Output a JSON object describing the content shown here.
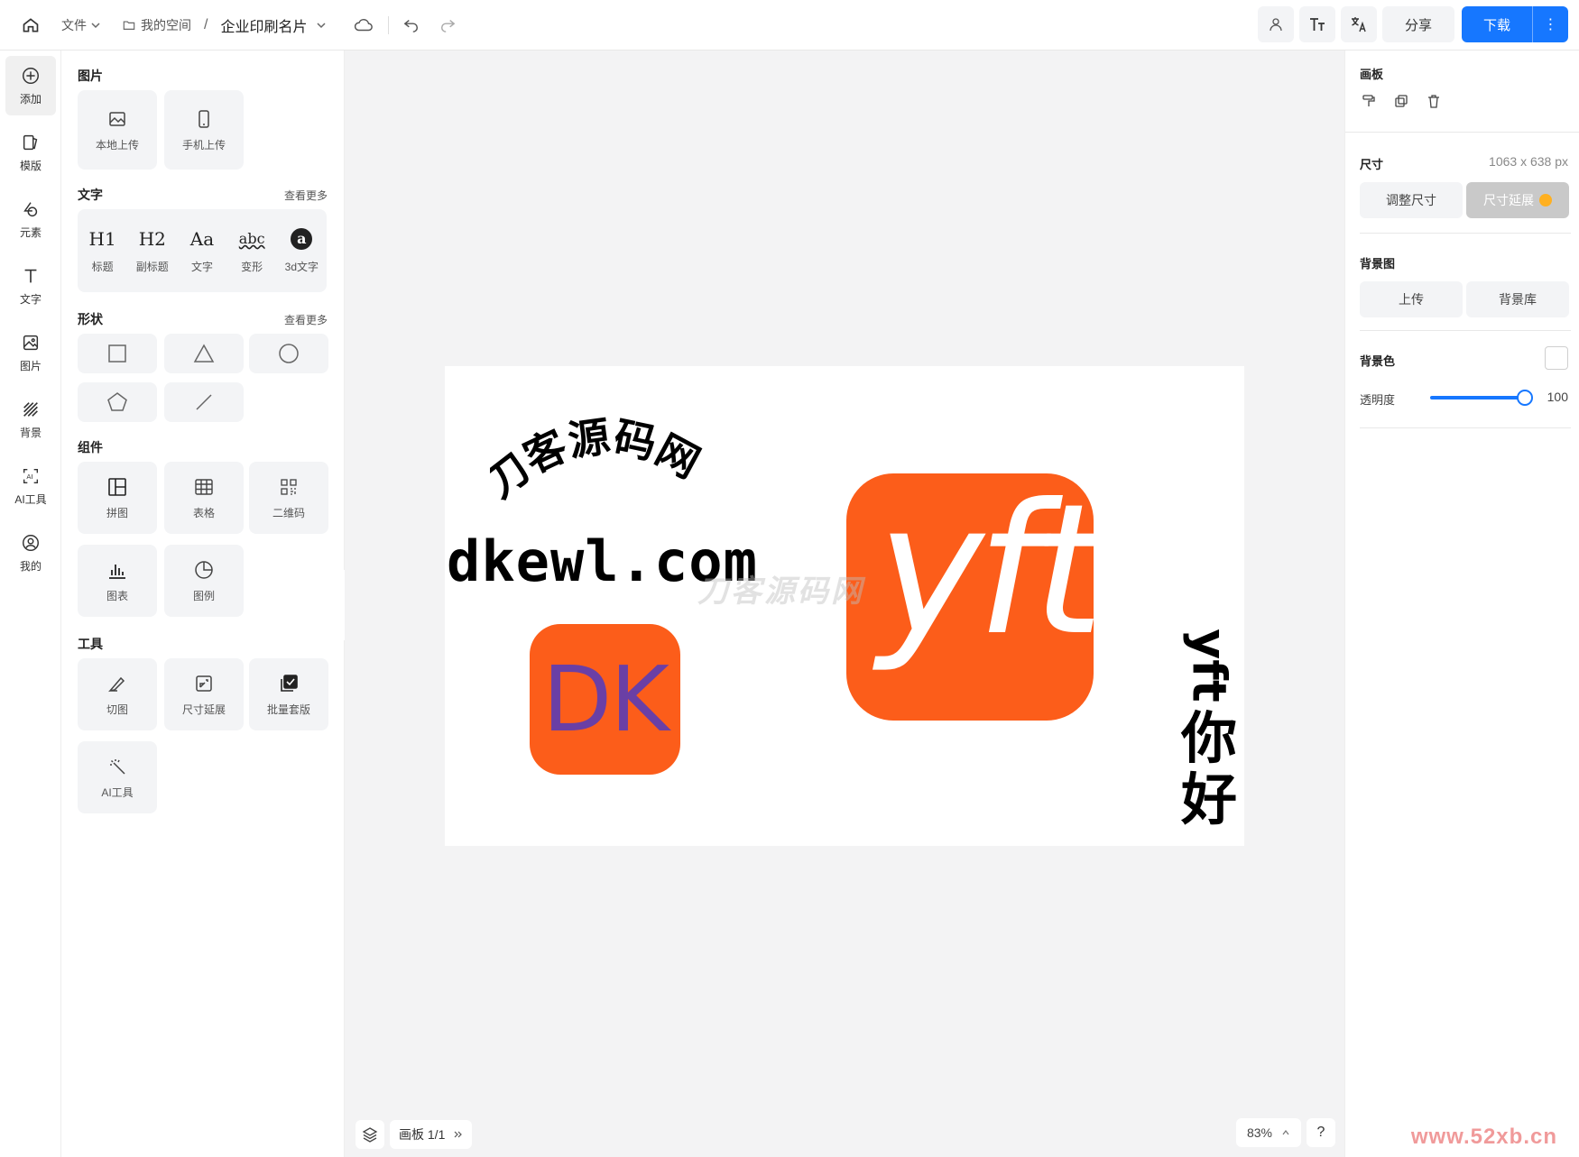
{
  "topbar": {
    "file_label": "文件",
    "space_label": "我的空间",
    "separator": "/",
    "doc_title": "企业印刷名片",
    "share_label": "分享",
    "download_label": "下载",
    "more_glyph": "⋮"
  },
  "rail": [
    {
      "label": "添加",
      "icon": "plus-circle-icon"
    },
    {
      "label": "模版",
      "icon": "template-icon"
    },
    {
      "label": "元素",
      "icon": "shapes-icon"
    },
    {
      "label": "文字",
      "icon": "text-icon"
    },
    {
      "label": "图片",
      "icon": "image-icon"
    },
    {
      "label": "背景",
      "icon": "hatch-icon"
    },
    {
      "label": "AI工具",
      "icon": "ai-icon"
    },
    {
      "label": "我的",
      "icon": "user-icon"
    }
  ],
  "panel": {
    "images": {
      "title": "图片",
      "local_upload": "本地上传",
      "phone_upload": "手机上传"
    },
    "text": {
      "title": "文字",
      "more": "查看更多",
      "items": [
        {
          "glyph": "H1",
          "label": "标题"
        },
        {
          "glyph": "H2",
          "label": "副标题"
        },
        {
          "glyph": "Aa",
          "label": "文字"
        },
        {
          "glyph": "abc",
          "label": "变形"
        },
        {
          "glyph": "a",
          "label": "3d文字"
        }
      ]
    },
    "shapes": {
      "title": "形状",
      "more": "查看更多"
    },
    "components": {
      "title": "组件",
      "items": [
        "拼图",
        "表格",
        "二维码",
        "图表",
        "图例"
      ]
    },
    "tools": {
      "title": "工具",
      "items": [
        "切图",
        "尺寸延展",
        "批量套版",
        "AI工具"
      ]
    }
  },
  "canvas": {
    "arc_text": "刀客源码网",
    "domain_text": "dkewl.com",
    "dk_text": "DK",
    "yft_text": "yft",
    "watermark": "刀客源码网",
    "vertical_latin": "yft",
    "vertical_cjk_1": "你",
    "vertical_cjk_2": "好",
    "board_label": "画板 1/1",
    "zoom": "83%",
    "help": "?"
  },
  "inspector": {
    "board_title": "画板",
    "size_label": "尺寸",
    "size_value": "1063 x 638 px",
    "resize_label": "调整尺寸",
    "extend_label": "尺寸延展",
    "bg_image_label": "背景图",
    "upload_label": "上传",
    "bg_library_label": "背景库",
    "bg_color_label": "背景色",
    "opacity_label": "透明度",
    "opacity_value": "100"
  },
  "colors": {
    "accent": "#1677ff",
    "logo_orange": "#fc5d1a",
    "dk_purple": "#6a3fa5"
  },
  "corner_watermark": "www.52xb.cn"
}
